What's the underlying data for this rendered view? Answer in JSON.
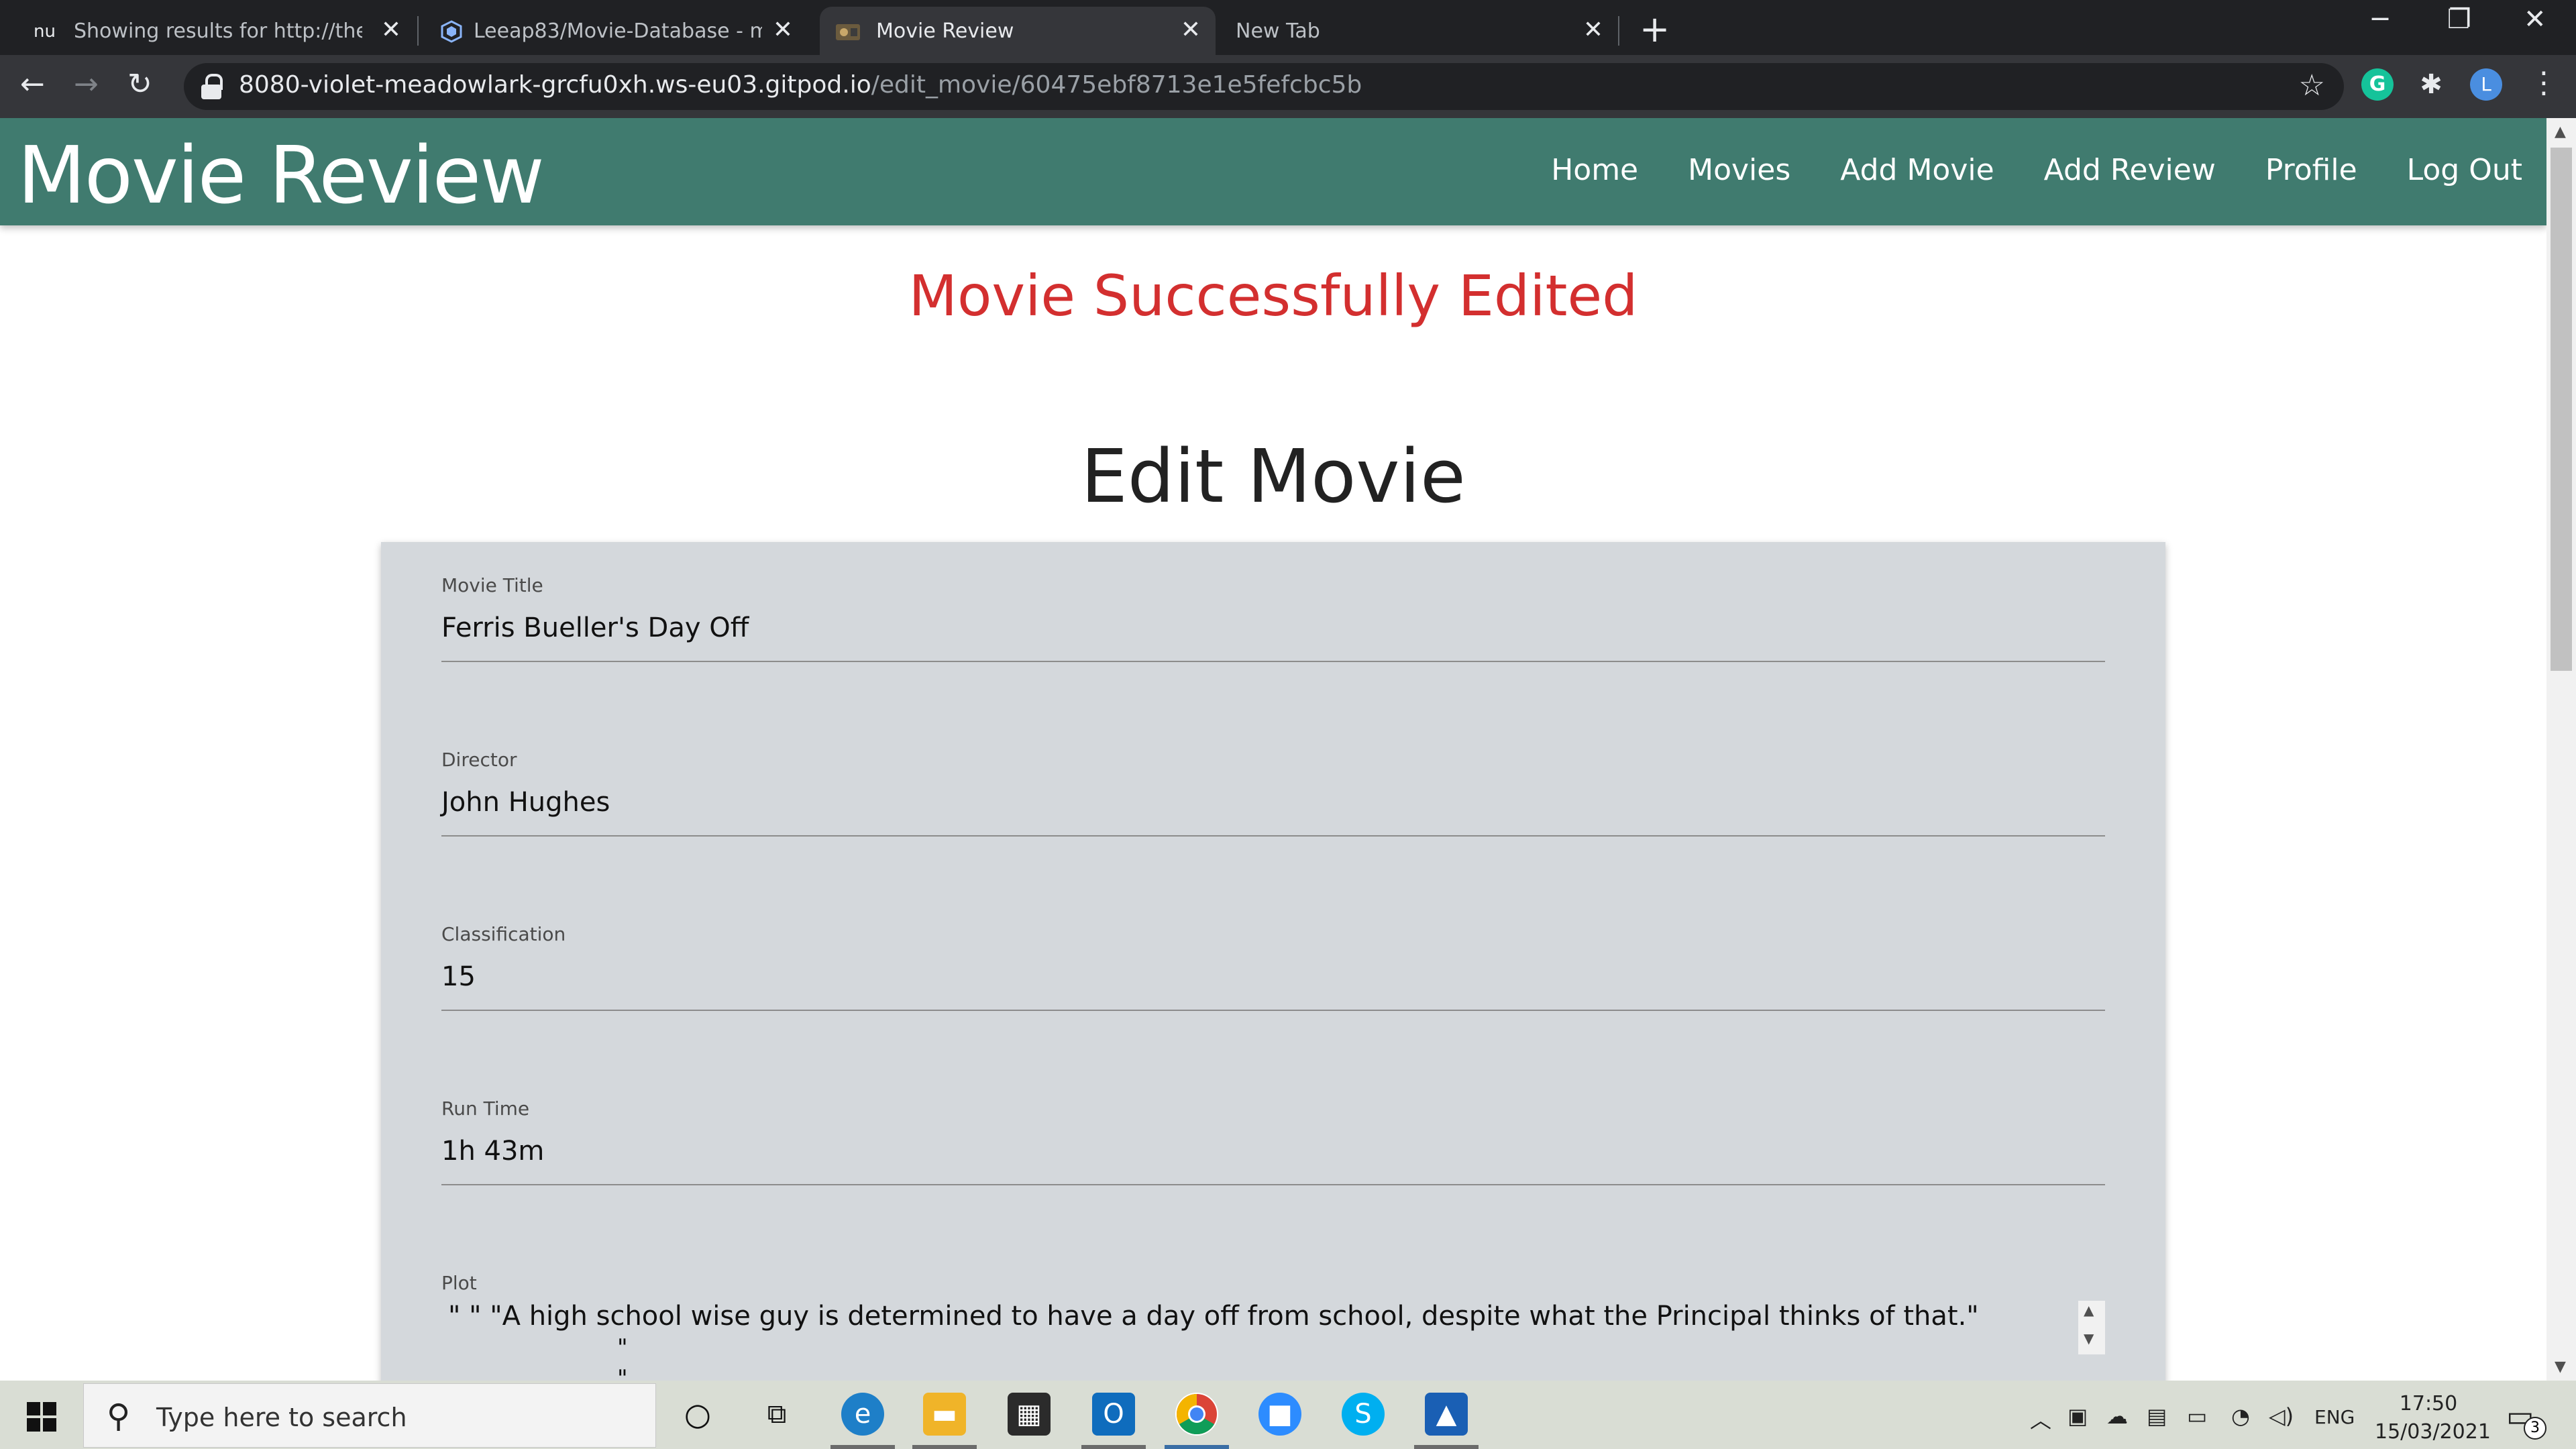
{
  "browser": {
    "tabs": [
      {
        "title": "Showing results for http://the-sn",
        "favicon": "nu"
      },
      {
        "title": "Leeap83/Movie-Database - mast",
        "favicon": "github-hex-icon"
      },
      {
        "title": "Movie Review",
        "favicon": "film-icon"
      },
      {
        "title": "New Tab",
        "favicon": ""
      }
    ],
    "new_tab_label": "+",
    "url_host": "8080-violet-meadowlark-grcfu0xh.ws-eu03.gitpod.io",
    "url_path": "/edit_movie/60475ebf8713e1e5fefcbc5b",
    "profile_initial": "L",
    "extension_initial": "G"
  },
  "site": {
    "brand": "Movie Review",
    "nav": [
      "Home",
      "Movies",
      "Add Movie",
      "Add Review",
      "Profile",
      "Log Out"
    ],
    "flash": "Movie Successfully Edited",
    "page_title": "Edit Movie"
  },
  "form": {
    "fields": [
      {
        "label": "Movie Title",
        "value": "Ferris Bueller's Day Off"
      },
      {
        "label": "Director",
        "value": "John Hughes"
      },
      {
        "label": "Classification",
        "value": "15"
      },
      {
        "label": "Run Time",
        "value": "1h 43m"
      }
    ],
    "plot": {
      "label": "Plot",
      "line1": "\" \" \"A high school wise guy is determined to have a day off from school, despite what the Principal thinks of that.\"",
      "line2": "\"",
      "line3": "\""
    }
  },
  "taskbar": {
    "search_placeholder": "Type here to search",
    "tray_language": "ENG",
    "time": "17:50",
    "date": "15/03/2021",
    "notification_count": "3"
  },
  "colors": {
    "navbar": "#407b6f",
    "flash": "#d32f2f",
    "card": "#d4d8dc"
  }
}
